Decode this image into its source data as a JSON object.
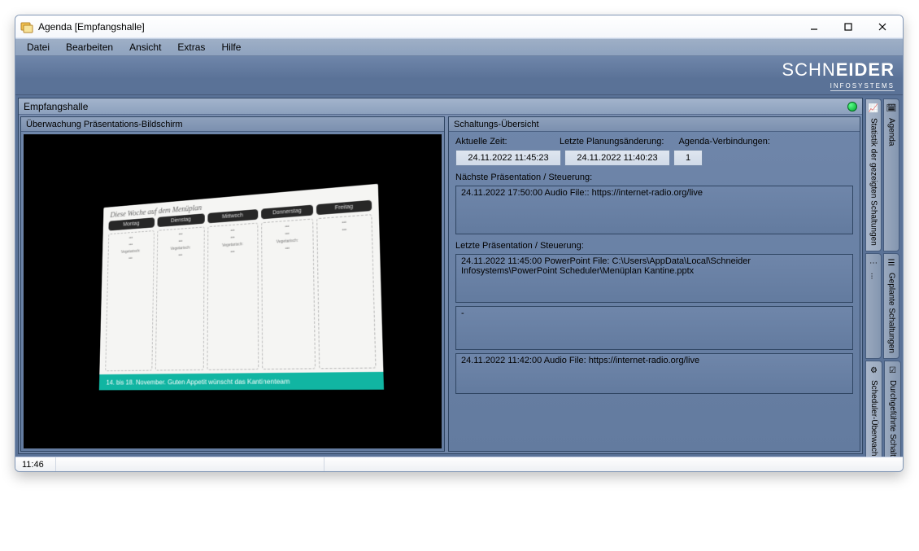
{
  "window_title": "Agenda [Empfangshalle]",
  "menubar": {
    "items": [
      "Datei",
      "Bearbeiten",
      "Ansicht",
      "Extras",
      "Hilfe"
    ]
  },
  "brand": {
    "main1": "SCHN",
    "main2": "EIDER",
    "sub": "INFOSYSTEMS"
  },
  "main_panel_title": "Empfangshalle",
  "monitor_title": "Überwachung Präsentations-Bildschirm",
  "slide": {
    "heading": "Diese Woche auf dem Menüplan",
    "days": [
      "Montag",
      "Dienstag",
      "Mittwoch",
      "Donnerstag",
      "Freitag"
    ],
    "footer": "14. bis 18. November. Guten Appetit wünscht das Kantinenteam",
    "veg_label": "Vegetarisch:"
  },
  "overview": {
    "title": "Schaltungs-Übersicht",
    "labels": {
      "current_time": "Aktuelle Zeit:",
      "last_plan_change": "Letzte Planungsänderung:",
      "agenda_connections": "Agenda-Verbindungen:",
      "next_presentation": "Nächste Präsentation / Steuerung:",
      "last_presentation": "Letzte Präsentation / Steuerung:"
    },
    "values": {
      "current_time": "24.11.2022 11:45:23",
      "last_plan_change": "24.11.2022 11:40:23",
      "agenda_connections": "1"
    },
    "next_presentation_text": "24.11.2022 17:50:00 Audio File:: https://internet-radio.org/live",
    "last_presentation_text": "24.11.2022 11:45:00 PowerPoint File: C:\\Users\\AppData\\Local\\Schneider Infosystems\\PowerPoint Scheduler\\Menüplan Kantine.pptx",
    "extra_box1": "-",
    "extra_box2": "24.11.2022 11:42:00 Audio File: https://internet-radio.org/live"
  },
  "tabs": {
    "r1a": "Statistik der gezeigten Schaltungen",
    "r1b": "Agenda",
    "r2a": "...",
    "r2b": "Geplante Schaltungen",
    "r3a": "Scheduler-Überwachungen",
    "r3b": "Durchgeführte Schaltungen"
  },
  "statusbar": {
    "clock": "11:46"
  }
}
